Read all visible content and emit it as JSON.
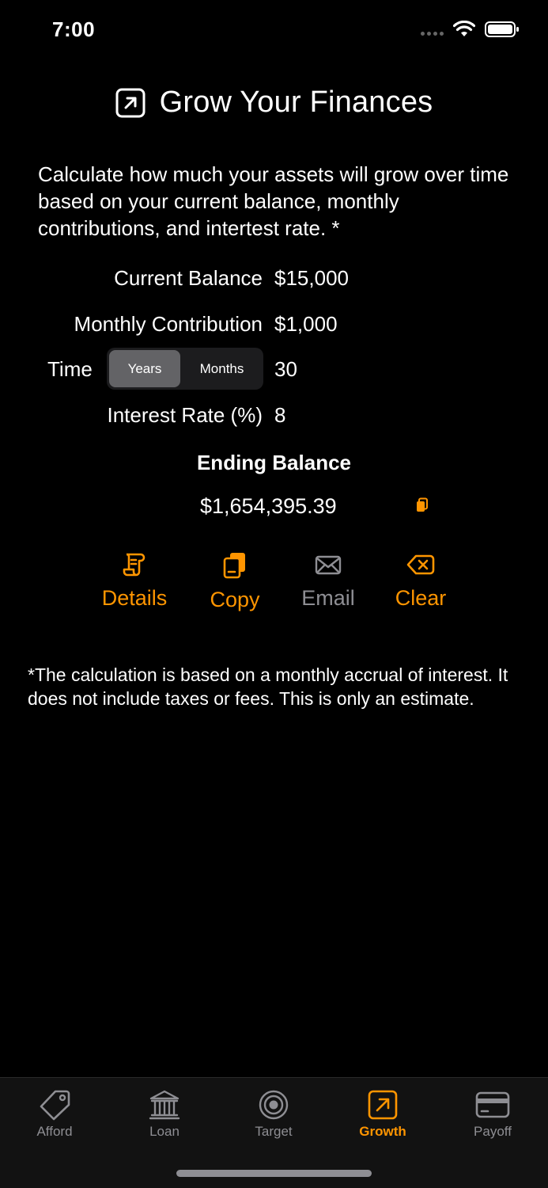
{
  "status_bar": {
    "time": "7:00"
  },
  "header": {
    "title": "Grow Your Finances",
    "icon": "arrow-up-right-square-icon"
  },
  "description": "Calculate how much your assets will grow over time based on your current balance, monthly contributions, and intertest rate. *",
  "form": {
    "current_balance": {
      "label": "Current Balance",
      "value": "$15,000"
    },
    "monthly_contribution": {
      "label": "Monthly Contribution",
      "value": "$1,000"
    },
    "time": {
      "label": "Time",
      "options": [
        "Years",
        "Months"
      ],
      "selected": "Years",
      "value": "30"
    },
    "interest_rate": {
      "label": "Interest Rate (%)",
      "value": "8"
    }
  },
  "result": {
    "title": "Ending Balance",
    "value": "$1,654,395.39"
  },
  "actions": [
    {
      "label": "Details",
      "icon": "scroll-icon",
      "color": "#ff9500"
    },
    {
      "label": "Copy",
      "icon": "copy-icon",
      "color": "#ff9500"
    },
    {
      "label": "Email",
      "icon": "envelope-icon",
      "color": "#8e8e93"
    },
    {
      "label": "Clear",
      "icon": "delete-left-icon",
      "color": "#ff9500"
    }
  ],
  "footnote": "*The calculation is based on a monthly accrual of interest.  It does not include taxes or fees.  This is only an estimate.",
  "tabs": [
    {
      "label": "Afford",
      "icon": "tag-icon",
      "active": false
    },
    {
      "label": "Loan",
      "icon": "bank-icon",
      "active": false
    },
    {
      "label": "Target",
      "icon": "target-icon",
      "active": false
    },
    {
      "label": "Growth",
      "icon": "arrow-up-right-square-icon",
      "active": true
    },
    {
      "label": "Payoff",
      "icon": "credit-card-icon",
      "active": false
    }
  ],
  "colors": {
    "accent": "#ff9500",
    "inactive": "#8e8e93",
    "background": "#000000"
  }
}
